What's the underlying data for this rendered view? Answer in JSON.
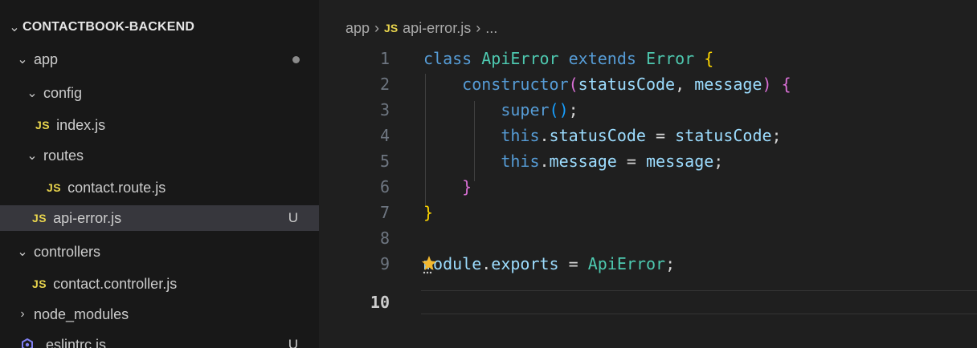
{
  "explorer": {
    "project_title": "CONTACTBOOK-BACKEND",
    "items": [
      {
        "label": "app",
        "type": "folder",
        "state": "expanded"
      },
      {
        "label": "config",
        "type": "folder",
        "state": "expanded"
      },
      {
        "label": "index.js",
        "type": "js-file",
        "file_icon_text": "JS"
      },
      {
        "label": "routes",
        "type": "folder",
        "state": "expanded"
      },
      {
        "label": "contact.route.js",
        "type": "js-file",
        "file_icon_text": "JS"
      },
      {
        "label": "api-error.js",
        "type": "js-file",
        "file_icon_text": "JS",
        "badge": "U",
        "selected": true
      },
      {
        "label": "controllers",
        "type": "folder",
        "state": "expanded"
      },
      {
        "label": "contact.controller.js",
        "type": "js-file",
        "file_icon_text": "JS"
      },
      {
        "label": "node_modules",
        "type": "folder",
        "state": "collapsed"
      },
      {
        "label": ".eslintrc.js",
        "type": "eslint-file",
        "badge": "U"
      }
    ]
  },
  "breadcrumb": {
    "folder": "app",
    "file_icon_text": "JS",
    "file": "api-error.js",
    "more": "..."
  },
  "editor": {
    "line_numbers": [
      "1",
      "2",
      "3",
      "4",
      "5",
      "6",
      "7",
      "8",
      "9",
      "10"
    ],
    "active_line": "10",
    "tokens": {
      "class_kw": "class",
      "class_name": "ApiError",
      "extends_kw": "extends",
      "base_class": "Error",
      "brace_open": "{",
      "brace_close": "}",
      "constructor_kw": "constructor",
      "paren_open": "(",
      "paren_close": ")",
      "param1": "statusCode",
      "comma": ",",
      "param2": "message",
      "super_kw": "super",
      "semicolon": ";",
      "this_kw": "this",
      "dot": ".",
      "prop1": "statusCode",
      "prop2": "message",
      "equals": "=",
      "module_kw": "module",
      "exports_prop": "exports",
      "export_value": "ApiError"
    }
  },
  "colors": {
    "js_icon": "#e8d44d",
    "keyword": "#569cd6",
    "class_name": "#4ec9b0",
    "function": "#dcdcaa",
    "variable": "#9cdcfe",
    "bracket_level_1": "#ffd700",
    "bracket_level_2": "#da70d6",
    "bracket_level_3": "#179fff"
  }
}
